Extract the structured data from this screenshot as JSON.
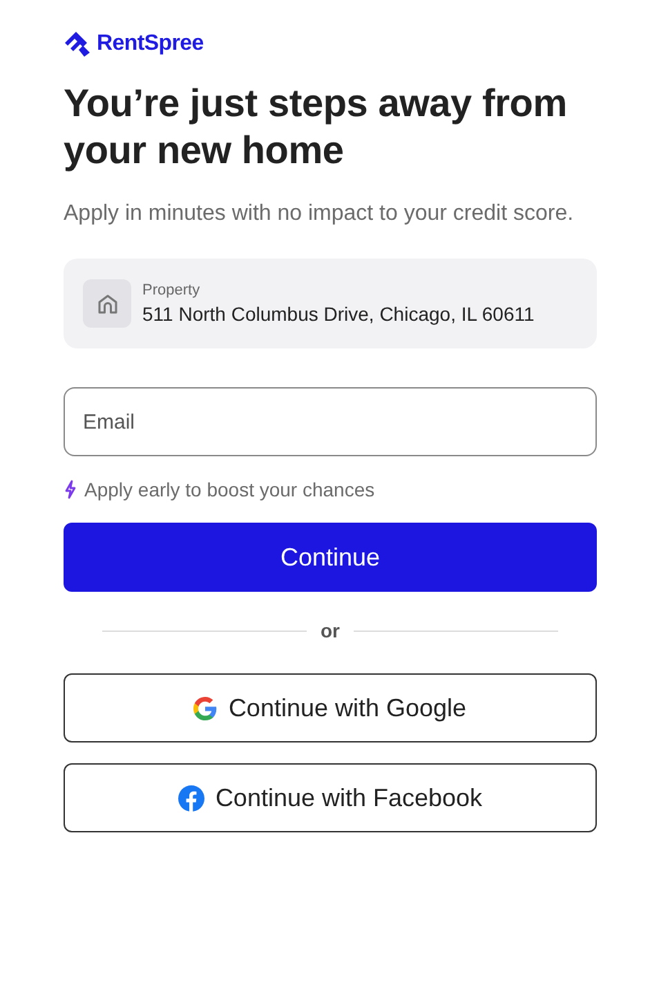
{
  "brand": {
    "name": "RentSpree"
  },
  "title": "You’re just steps away from your new home",
  "subtitle": "Apply in minutes with no impact to your credit score.",
  "property": {
    "label": "Property",
    "address": "511 North Columbus Drive, Chicago, IL 60611"
  },
  "email": {
    "placeholder": "Email"
  },
  "hint": "Apply early to boost your chances",
  "primary_button": "Continue",
  "divider": "or",
  "social_buttons": [
    {
      "kind": "google",
      "label": "Continue with Google"
    },
    {
      "kind": "facebook",
      "label": "Continue with Facebook"
    }
  ]
}
